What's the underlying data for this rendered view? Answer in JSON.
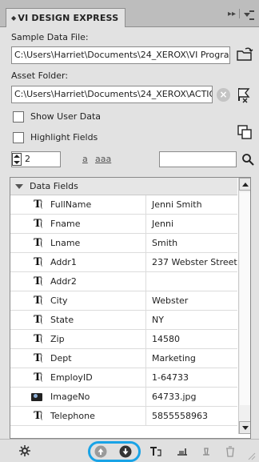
{
  "panel": {
    "title": "VI DESIGN EXPRESS",
    "close_glyph": "×",
    "collapse_glyph": "▸▸"
  },
  "sample_data": {
    "label": "Sample Data File:",
    "path": "C:\\Users\\Harriet\\Documents\\24_XEROX\\VI Progra",
    "browse_icon": "folder-browse-icon"
  },
  "asset_folder": {
    "label": "Asset Folder:",
    "path": "C:\\Users\\Harriet\\Documents\\24_XEROX\\ACTIO",
    "clear_icon": "clear-icon",
    "browse_icon": "folder-browse-icon"
  },
  "options": {
    "show_user_data": "Show User Data",
    "highlight_fields": "Highlight Fields"
  },
  "record": {
    "number": "2",
    "case_lower": "a",
    "case_multi": "aaa",
    "search_value": ""
  },
  "grid": {
    "header": "Data Fields",
    "rows": [
      {
        "field": "FullName",
        "value": "Jenni Smith",
        "kind": "text"
      },
      {
        "field": "Fname",
        "value": "Jenni",
        "kind": "text"
      },
      {
        "field": "Lname",
        "value": "Smith",
        "kind": "text"
      },
      {
        "field": "Addr1",
        "value": "237 Webster Street",
        "kind": "text"
      },
      {
        "field": "Addr2",
        "value": "",
        "kind": "text"
      },
      {
        "field": "City",
        "value": "Webster",
        "kind": "text"
      },
      {
        "field": "State",
        "value": "NY",
        "kind": "text"
      },
      {
        "field": "Zip",
        "value": "14580",
        "kind": "text"
      },
      {
        "field": "Dept",
        "value": "Marketing",
        "kind": "text"
      },
      {
        "field": "EmployID",
        "value": "1-64733",
        "kind": "text"
      },
      {
        "field": "ImageNo",
        "value": "64733.jpg",
        "kind": "image"
      },
      {
        "field": "Telephone",
        "value": "5855558963",
        "kind": "text"
      }
    ]
  },
  "colors": {
    "highlight": "#19a3e6",
    "panel_bg": "#e2e2e2"
  }
}
